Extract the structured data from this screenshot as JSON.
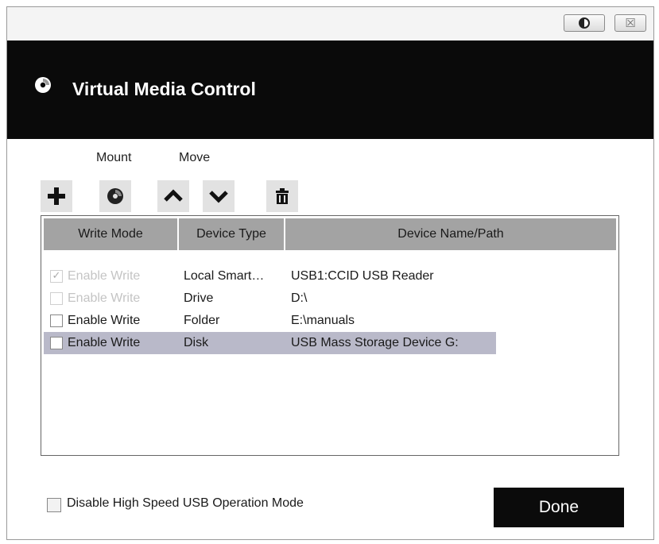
{
  "titlebar": {
    "theme_icon": "contrast-icon",
    "close_glyph": "☒"
  },
  "banner": {
    "icon": "disc-icon",
    "title": "Virtual Media Control"
  },
  "toolbar": {
    "mount_label": "Mount",
    "move_label": "Move",
    "buttons": [
      {
        "name": "add-icon"
      },
      {
        "name": "mount-disc-icon"
      },
      {
        "name": "move-up-icon"
      },
      {
        "name": "move-down-icon"
      },
      {
        "name": "trash-icon"
      }
    ]
  },
  "table": {
    "columns": [
      "Write Mode",
      "Device Type",
      "Device Name/Path"
    ],
    "rows": [
      {
        "write_label": "Enable Write",
        "checked": true,
        "disabled": true,
        "type": "Local Smart…",
        "path": "USB1:CCID USB Reader",
        "selected": false
      },
      {
        "write_label": "Enable Write",
        "checked": false,
        "disabled": true,
        "type": "Drive",
        "path": "D:\\",
        "selected": false
      },
      {
        "write_label": "Enable Write",
        "checked": false,
        "disabled": false,
        "type": "Folder",
        "path": "E:\\manuals",
        "selected": false
      },
      {
        "write_label": "Enable Write",
        "checked": false,
        "disabled": false,
        "type": "Disk",
        "path": "USB Mass Storage Device G:",
        "selected": true
      }
    ]
  },
  "footer": {
    "checkbox_label": "Disable High Speed USB Operation Mode",
    "checkbox_checked": false,
    "done_label": "Done"
  },
  "colors": {
    "banner_bg": "#0a0a0a",
    "header_bg": "#a3a3a3",
    "selection_bg": "#b9b9c9",
    "done_bg": "#0b0b0b"
  }
}
